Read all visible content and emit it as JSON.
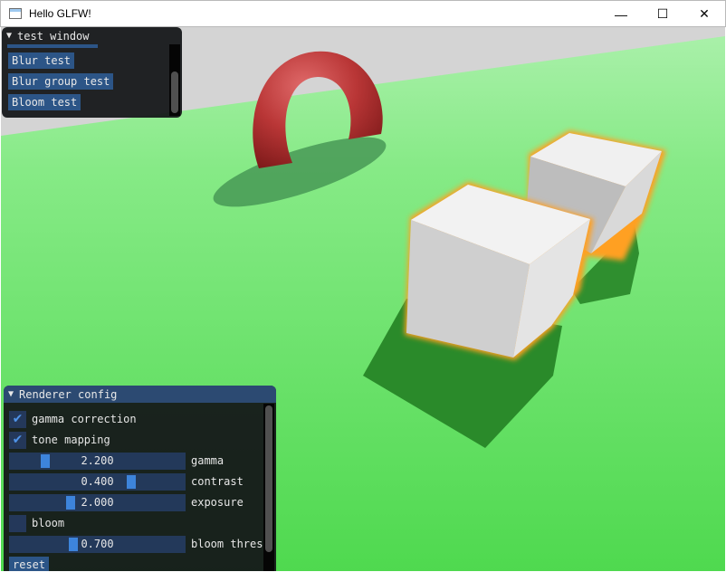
{
  "window": {
    "title": "Hello GLFW!",
    "minimize": "—",
    "maximize": "☐",
    "close": "✕"
  },
  "test_window": {
    "title": "test window",
    "buttons": [
      "Blur test",
      "Blur group test",
      "Bloom test"
    ]
  },
  "renderer_config": {
    "title": "Renderer config",
    "gamma_correction": {
      "label": "gamma correction",
      "checked": true
    },
    "tone_mapping": {
      "label": "tone mapping",
      "checked": true
    },
    "sliders": [
      {
        "label": "gamma",
        "value": "2.200"
      },
      {
        "label": "contrast",
        "value": "0.400"
      },
      {
        "label": "exposure",
        "value": "2.000"
      }
    ],
    "bloom": {
      "label": "bloom",
      "checked": false
    },
    "bloom_threshold": {
      "label": "bloom thres",
      "value": "0.700"
    },
    "reset_label": "reset"
  },
  "colors": {
    "ground": "#5fe05f",
    "sky": "#d9d9d9",
    "torus": "#b23232",
    "cube": "#e6e6e6",
    "glow": "#ffa020",
    "accent": "#3d84db"
  }
}
